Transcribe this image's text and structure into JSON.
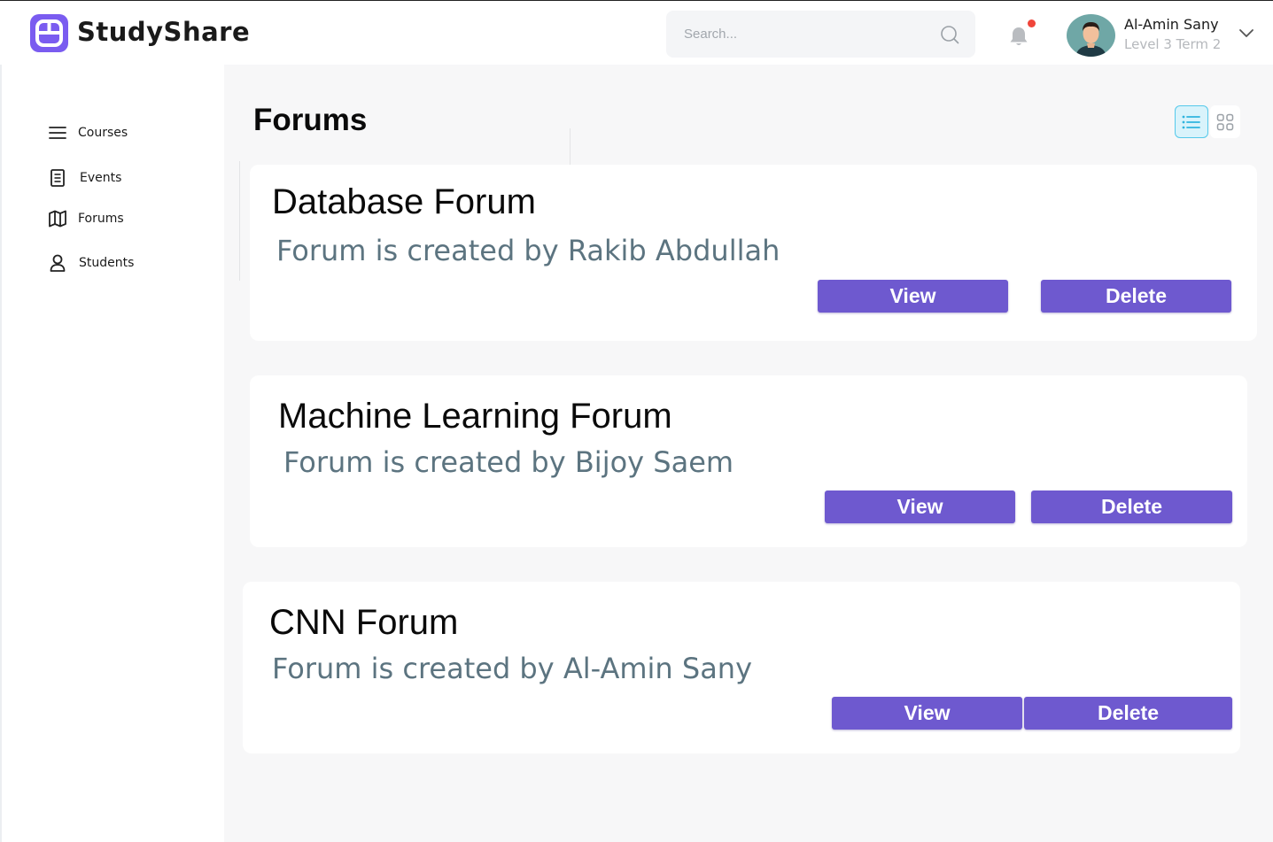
{
  "header": {
    "brand": "StudyShare",
    "search": {
      "placeholder": "Search...",
      "value": ""
    },
    "user": {
      "name": "Al-Amin Sany",
      "level": "Level 3 Term 2"
    },
    "notification_dot_color": "#f0453a"
  },
  "sidebar": {
    "items": [
      {
        "label": "Courses",
        "icon": "menu-icon"
      },
      {
        "label": "Events",
        "icon": "document-icon"
      },
      {
        "label": "Forums",
        "icon": "map-icon"
      },
      {
        "label": "Students",
        "icon": "user-icon"
      }
    ]
  },
  "main": {
    "title": "Forums",
    "view_toggle": {
      "active": "list"
    },
    "forums": [
      {
        "title": "Database Forum",
        "subtitle": "Forum is created by Rakib Abdullah",
        "view_label": "View",
        "delete_label": "Delete"
      },
      {
        "title": "Machine Learning Forum",
        "subtitle": "Forum is created by Bijoy Saem",
        "view_label": "View",
        "delete_label": "Delete"
      },
      {
        "title": "CNN Forum",
        "subtitle": "Forum is created by Al-Amin Sany",
        "view_label": "View",
        "delete_label": "Delete"
      }
    ]
  },
  "colors": {
    "accent": "#6e59cf",
    "subtitle": "#5c7480",
    "active_toggle_bg": "#d9f3fb",
    "active_toggle_border": "#55c9ea",
    "background": "#f7f7f8"
  }
}
